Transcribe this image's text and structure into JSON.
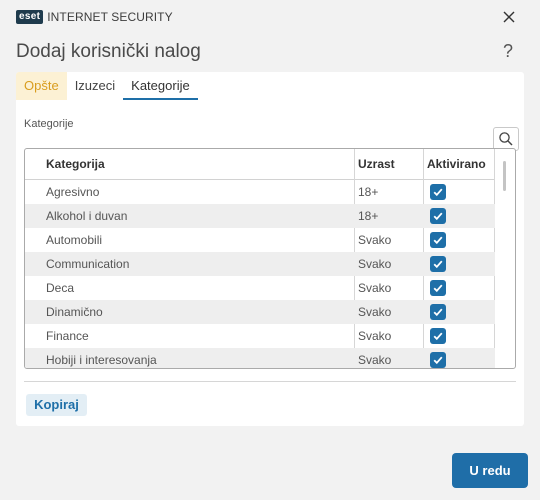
{
  "app": {
    "logo_badge": "eset",
    "logo_text": "INTERNET SECURITY",
    "close_icon": "close-icon"
  },
  "dialog": {
    "title": "Dodaj korisnički nalog",
    "help_label": "?"
  },
  "tabs": [
    {
      "label": "Opšte"
    },
    {
      "label": "Izuzeci"
    },
    {
      "label": "Kategorije",
      "active": true
    }
  ],
  "section": {
    "label": "Kategorije",
    "search_icon": "search-icon"
  },
  "table": {
    "headers": [
      "Kategorija",
      "Uzrast",
      "Aktivirano"
    ],
    "rows": [
      {
        "category": "Agresivno",
        "age": "18+",
        "enabled": true
      },
      {
        "category": "Alkohol i duvan",
        "age": "18+",
        "enabled": true
      },
      {
        "category": "Automobili",
        "age": "Svako",
        "enabled": true
      },
      {
        "category": "Communication",
        "age": "Svako",
        "enabled": true
      },
      {
        "category": "Deca",
        "age": "Svako",
        "enabled": true
      },
      {
        "category": "Dinamično",
        "age": "Svako",
        "enabled": true
      },
      {
        "category": "Finance",
        "age": "Svako",
        "enabled": true
      },
      {
        "category": "Hobiji i interesovanja",
        "age": "Svako",
        "enabled": true
      }
    ]
  },
  "buttons": {
    "copy": "Kopiraj",
    "ok": "U redu"
  },
  "colors": {
    "accent": "#1e6fa8",
    "tab_highlight_bg": "#fcf1d4",
    "tab_highlight_text": "#d99d1e",
    "logo_bg": "#1f3b4d"
  }
}
